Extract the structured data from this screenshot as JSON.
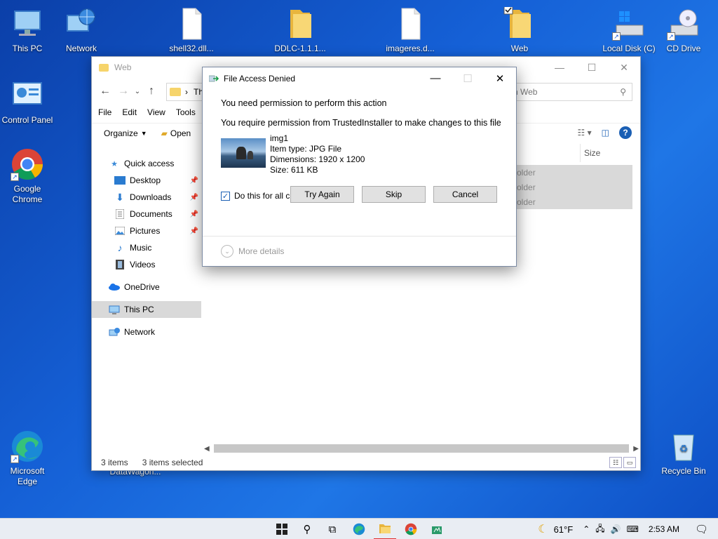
{
  "desktop": {
    "icons": [
      {
        "label": "This PC",
        "icon": "this-pc-icon"
      },
      {
        "label": "Network",
        "icon": "network-icon"
      },
      {
        "label": "shell32.dll...",
        "icon": "file-icon"
      },
      {
        "label": "DDLC-1.1.1...",
        "icon": "folder-icon"
      },
      {
        "label": "imageres.d...",
        "icon": "file-icon"
      },
      {
        "label": "Web",
        "icon": "folder-icon"
      },
      {
        "label": "Local Disk (C)",
        "icon": "drive-icon"
      },
      {
        "label": "CD Drive",
        "icon": "cd-drive-icon"
      },
      {
        "label": "Control Panel",
        "icon": "control-panel-icon"
      },
      {
        "label": "Google Chrome",
        "icon": "chrome-icon"
      },
      {
        "label": "Microsoft Edge",
        "icon": "edge-icon"
      },
      {
        "label": "Recycle Bin",
        "icon": "recycle-bin-icon"
      },
      {
        "label": "DataWagon...",
        "icon": "file-icon"
      }
    ]
  },
  "explorer": {
    "title": "Web",
    "address_text": "Th",
    "search_placeholder": "h Web",
    "menu": [
      "File",
      "Edit",
      "View",
      "Tools"
    ],
    "toolbar": {
      "organize": "Organize",
      "open": "Open"
    },
    "nav_items": [
      {
        "label": "Quick access"
      },
      {
        "label": "Desktop"
      },
      {
        "label": "Downloads"
      },
      {
        "label": "Documents"
      },
      {
        "label": "Pictures"
      },
      {
        "label": "Music"
      },
      {
        "label": "Videos"
      },
      {
        "label": "OneDrive"
      },
      {
        "label": "This PC"
      },
      {
        "label": "Network"
      }
    ],
    "column_size": "Size",
    "rows": [
      "older",
      "older",
      "older"
    ],
    "status": {
      "items": "3 items",
      "selected": "3 items selected"
    }
  },
  "dialog": {
    "title": "File Access Denied",
    "heading": "You need permission to perform this action",
    "sub": "You require permission from TrustedInstaller to make changes to this file",
    "file": {
      "name": "img1",
      "type": "Item type: JPG File",
      "dimensions": "Dimensions: 1920 x 1200",
      "size": "Size: 611 KB"
    },
    "checkbox_label": "Do this for all current items",
    "checkbox_checked": true,
    "buttons": {
      "try_again": "Try Again",
      "skip": "Skip",
      "cancel": "Cancel"
    },
    "more_details": "More details"
  },
  "taskbar": {
    "weather": "61°F",
    "time": "2:53 AM"
  }
}
